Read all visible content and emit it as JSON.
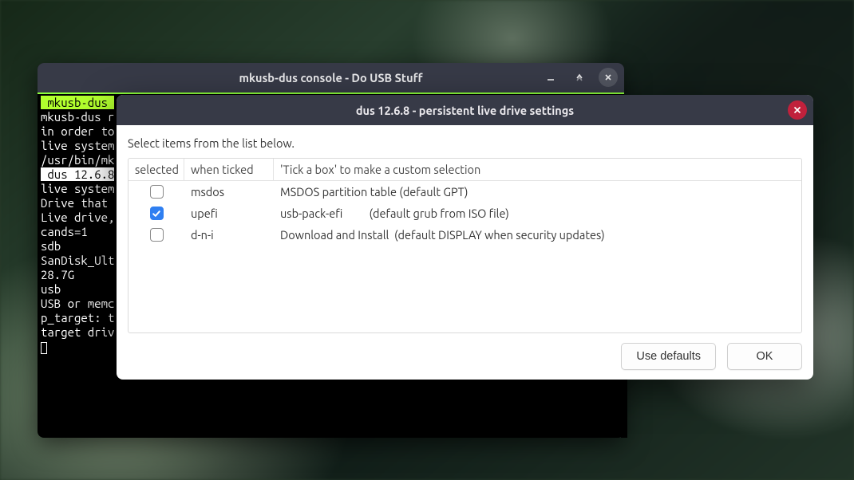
{
  "console": {
    "title": "mkusb-dus console - Do USB Stuff",
    "lines": {
      "l0": " mkusb-dus ",
      "l1": "mkusb-dus r",
      "l2": "in order to",
      "l3": "live system",
      "l4": "/usr/bin/mk",
      "l5": " dus 12.6.8",
      "l6": "live system",
      "l7": "Drive that ",
      "l8": "Live drive,",
      "l9": "cands=1",
      "l10": "sdb",
      "l11": "SanDisk_Ult",
      "l12": "28.7G",
      "l13": "usb",
      "l14": "USB or memc",
      "l15": "p_target: t",
      "l16": "target driv"
    }
  },
  "dialog": {
    "title": "dus 12.6.8 - persistent live drive settings",
    "instruction": "Select items from the list below.",
    "headers": {
      "selected": "selected",
      "when": "when ticked",
      "desc": "'Tick a box' to make a custom selection"
    },
    "rows": [
      {
        "checked": false,
        "when": "msdos",
        "desc": "MSDOS partition table (default GPT)"
      },
      {
        "checked": true,
        "when": "upefi",
        "desc": "usb-pack-efi          (default grub from ISO file)"
      },
      {
        "checked": false,
        "when": "d-n-i",
        "desc": "Download and Install  (default DISPLAY when security updates)"
      }
    ],
    "buttons": {
      "defaults": "Use defaults",
      "ok": "OK"
    }
  }
}
